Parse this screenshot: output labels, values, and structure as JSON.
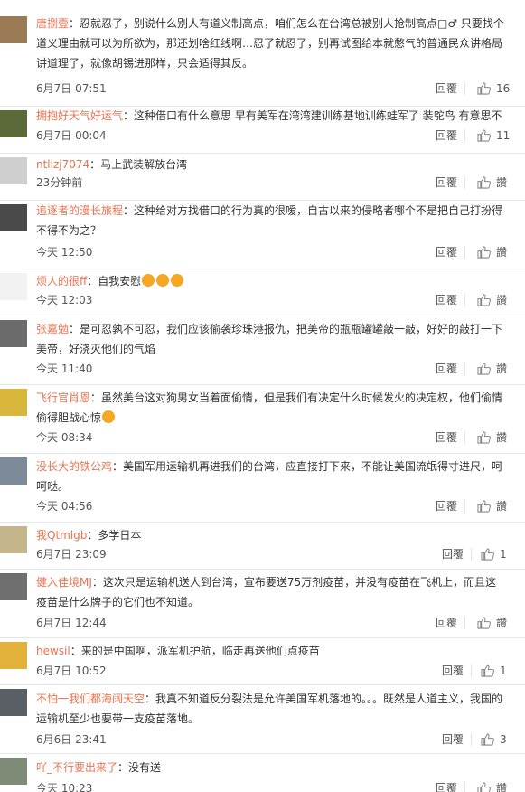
{
  "comments": [
    {
      "user": "唐捌壹",
      "text": "：忍就忍了，别说什么别人有道义制高点，咱们怎么在台湾总被别人抢制高点□♂ 只要找个道义理由就可以为所欲为，那还划啥红线啊…忍了就忍了，别再试图给本就憋气的普通民众讲格局讲道理了，就像胡锡进那样，只会适得其反。",
      "time": "6月7日 07:51",
      "reply": "回覆",
      "likes": "16",
      "avatar_color": "#9a7b55"
    },
    {
      "user": "拥抱好天气好运气",
      "text": "：这种借口有什么意思 早有美军在湾湾建训练基地训练蛙军了 装鸵鸟 有意思不",
      "time": "6月7日 00:04",
      "reply": "回覆",
      "likes": "11",
      "avatar_color": "#5c6a3a"
    },
    {
      "user": "ntllzj7074",
      "text": "：马上武装解放台湾",
      "time": "23分钟前",
      "reply": "回覆",
      "likes": "讚",
      "avatar_color": "#cfcfcf"
    },
    {
      "user": "追逐者的漫长旅程",
      "text": "：这种给对方找借口的行为真的很嗳，自古以来的侵略者哪个不是把自己打扮得不得不为之？",
      "time": "今天 12:50",
      "reply": "回覆",
      "likes": "讚",
      "avatar_color": "#4a4a4a"
    },
    {
      "user": "烦人的很ff",
      "text": "：自我安慰",
      "time": "今天 12:03",
      "reply": "回覆",
      "likes": "讚",
      "avatar_color": "#f2f2f2",
      "emoji_count": 3
    },
    {
      "user": "张嘉勉",
      "text": "：是可忍孰不可忍，我们应该偷袭珍珠港报仇，把美帝的瓶瓶罐罐敲一敲，好好的敲打一下美帝，好浇灭他们的气焰",
      "time": "今天 11:40",
      "reply": "回覆",
      "likes": "讚",
      "avatar_color": "#6b6b6b"
    },
    {
      "user": "飞行官肖恩",
      "text": "：虽然美台这对狗男女当着面偷情，但是我们有决定什么时候发火的决定权，他们偷情偷得胆战心惊",
      "time": "今天 08:34",
      "reply": "回覆",
      "likes": "讚",
      "avatar_color": "#d9b63c",
      "emoji_count": 1
    },
    {
      "user": "没长大的铁公鸡",
      "text": "：美国军用运输机再进我们的台湾，应直接打下来，不能让美国流氓得寸进尺，呵呵哒。",
      "time": "今天 04:56",
      "reply": "回覆",
      "likes": "讚",
      "avatar_color": "#7d8a9a"
    },
    {
      "user": "我Qtmlgb",
      "text": "：多学日本",
      "time": "6月7日 23:09",
      "reply": "回覆",
      "likes": "1",
      "avatar_color": "#c4b58a"
    },
    {
      "user": "健入佳境MJ",
      "text": "：这次只是运输机送人到台湾，宣布要送75万剂疫苗，并没有疫苗在飞机上，而且这疫苗是什么牌子的它们也不知道。",
      "time": "6月7日 12:44",
      "reply": "回覆",
      "likes": "讚",
      "avatar_color": "#6e6e6e"
    },
    {
      "user": "hewsil",
      "text": "：来的是中国啊，派军机护航，临走再送他们点疫苗",
      "time": "6月7日 10:52",
      "reply": "回覆",
      "likes": "1",
      "avatar_color": "#e2b23a"
    },
    {
      "user": "不怕一我们都海阔天空",
      "text": "：我真不知道反分裂法是允许美国军机落地的。。。既然是人道主义，我国的运输机至少也要带一支疫苗落地。",
      "time": "6月6日 23:41",
      "reply": "回覆",
      "likes": "3",
      "avatar_color": "#5a5f66"
    },
    {
      "user": "吖_不行要出来了",
      "text": "：没有送",
      "time": "今天 10:23",
      "reply": "回覆",
      "likes": "讚",
      "avatar_color": "#7f8a77"
    }
  ]
}
